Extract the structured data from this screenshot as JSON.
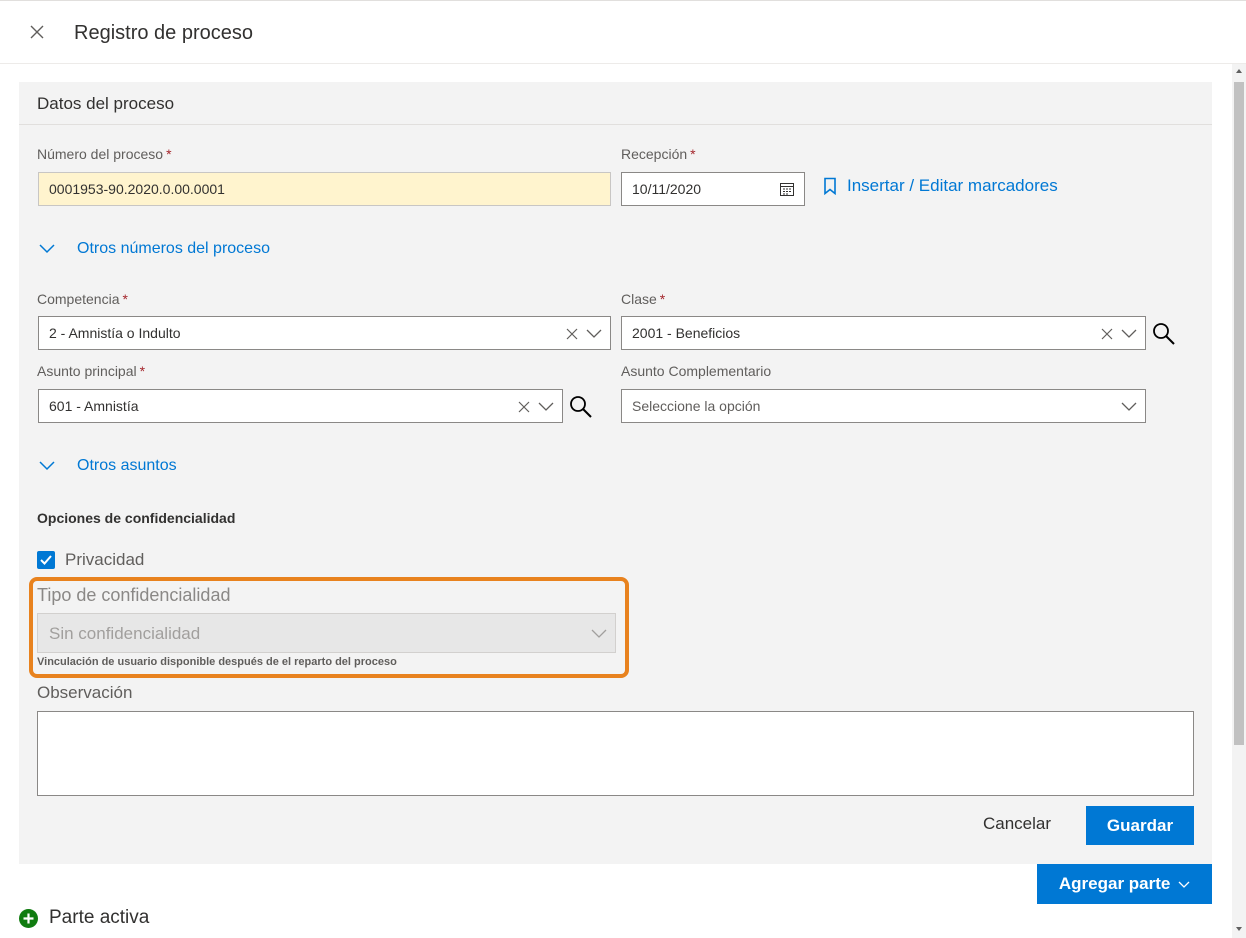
{
  "header": {
    "title": "Registro de proceso"
  },
  "section": {
    "title": "Datos del proceso",
    "numero": {
      "label": "Número del proceso",
      "value": "0001953-90.2020.0.00.0001"
    },
    "recepcion": {
      "label": "Recepción",
      "value": "10/11/2020"
    },
    "marcadores_link": "Insertar / Editar marcadores",
    "otros_numeros": "Otros números del proceso",
    "competencia": {
      "label": "Competencia",
      "value": "2 - Amnistía o Indulto"
    },
    "clase": {
      "label": "Clase",
      "value": "2001 - Beneficios"
    },
    "asunto_principal": {
      "label": "Asunto principal",
      "value": "601 - Amnistía"
    },
    "asunto_complementario": {
      "label": "Asunto Complementario",
      "placeholder": "Seleccione la opción"
    },
    "otros_asuntos": "Otros asuntos",
    "confidencialidad_title": "Opciones de confidencialidad",
    "privacidad": {
      "label": "Privacidad",
      "checked": true
    },
    "tipo": {
      "label": "Tipo de confidencialidad",
      "value": "Sin confidencialidad",
      "hint": "Vinculación de usuario disponible después de el reparto del proceso"
    },
    "observacion": {
      "label": "Observación",
      "value": ""
    },
    "required_mark": "*"
  },
  "actions": {
    "cancel": "Cancelar",
    "save": "Guardar",
    "add_part": "Agregar parte"
  },
  "parte_activa": "Parte activa",
  "colors": {
    "primary": "#0078d4",
    "highlight": "#e8821e",
    "required": "#a4262c",
    "success": "#107c10"
  }
}
